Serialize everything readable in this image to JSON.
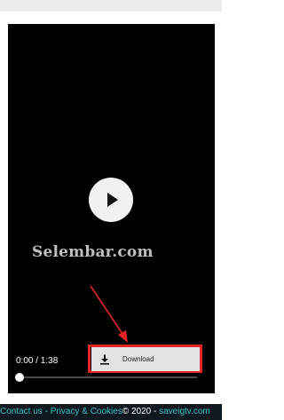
{
  "video": {
    "watermark": "Selembar.com",
    "time": "0:00 / 1:38",
    "progress": 0,
    "play_icon": "play-icon"
  },
  "download": {
    "label": "Download",
    "icon": "download-icon",
    "highlight_color": "#e52424"
  },
  "footer": {
    "contact": "Contact us",
    "sep": " - ",
    "privacy": "Privacy & Cookies",
    "copyright": "© 2020 - ",
    "site": "saveigtv.com"
  },
  "colors": {
    "video_bg": "#000000",
    "footer_bg": "#101820",
    "footer_link": "#35c0c8",
    "annotation": "#e52424"
  }
}
